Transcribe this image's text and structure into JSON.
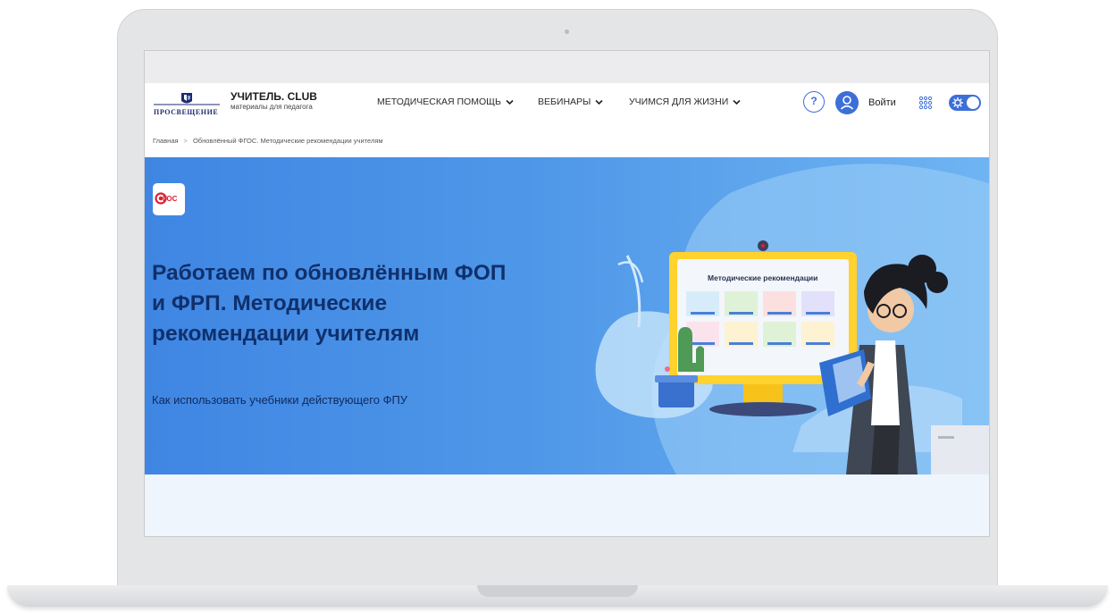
{
  "header": {
    "logo_text": "ПРОСВЕЩЕНИЕ",
    "brand_title": "УЧИТЕЛЬ. CLUB",
    "brand_subtitle": "материалы для педагога",
    "nav": [
      {
        "label": "МЕТОДИЧЕСКАЯ ПОМОЩЬ"
      },
      {
        "label": "ВЕБИНАРЫ"
      },
      {
        "label": "УЧИМСЯ ДЛЯ ЖИЗНИ"
      }
    ],
    "help_label": "?",
    "login_label": "Войти"
  },
  "breadcrumb": {
    "home": "Главная",
    "separator": ">",
    "current": "Обновлённый ФГОС. Методические рекомендации учителям"
  },
  "hero": {
    "badge_text": "ГОС",
    "title_lines": [
      "Работаем по обновлённым ФОП",
      "и ФРП. Методические",
      "рекомендации учителям"
    ],
    "subtitle": "Как использовать учебники действующего ФПУ",
    "monitor_title": "Методические рекомендации"
  },
  "colors": {
    "accent": "#3d6fd8",
    "hero_start": "#3f86e3",
    "hero_end": "#6fb4f2",
    "title_text": "#10306b",
    "badge_red": "#d9222f"
  },
  "icons": [
    "question-icon",
    "user-icon",
    "apps-grid-icon",
    "gear-icon",
    "chevron-down-icon"
  ]
}
